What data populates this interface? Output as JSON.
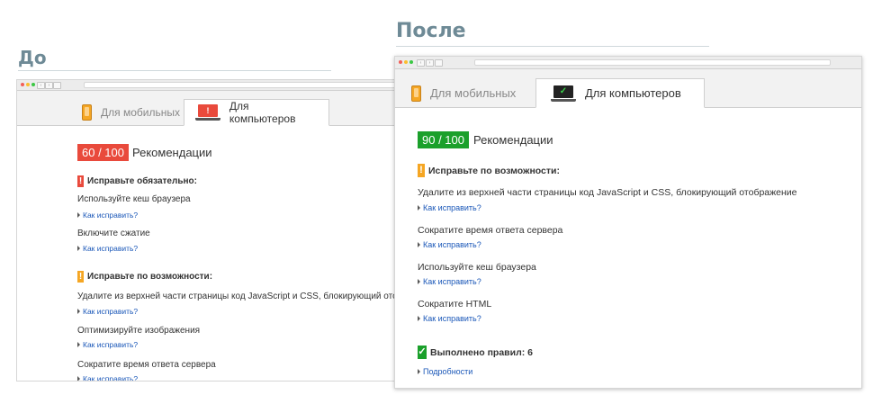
{
  "headings": {
    "before": "До",
    "after": "После"
  },
  "tabs": {
    "mobile": "Для мобильных",
    "desktop": "Для компьютеров"
  },
  "before": {
    "score": "60 / 100",
    "score_label": "Рекомендации",
    "sections": [
      {
        "title": "Исправьте обязательно:",
        "badge": "!",
        "rules": [
          {
            "text": "Используйте кеш браузера",
            "link": "Как исправить?"
          },
          {
            "text": "Включите сжатие",
            "link": "Как исправить?"
          }
        ]
      },
      {
        "title": "Исправьте по возможности:",
        "badge": "!",
        "rules": [
          {
            "text": "Удалите из верхней части страницы код JavaScript и CSS, блокирующий отобра",
            "link": "Как исправить?"
          },
          {
            "text": "Оптимизируйте изображения",
            "link": "Как исправить?"
          },
          {
            "text": "Сократите время ответа сервера",
            "link": "Как исправить?"
          }
        ]
      }
    ]
  },
  "after": {
    "score": "90 / 100",
    "score_label": "Рекомендации",
    "section_title": "Исправьте по возможности:",
    "badge": "!",
    "rules": [
      {
        "text": "Удалите из верхней части страницы код JavaScript и CSS, блокирующий отображение",
        "link": "Как исправить?"
      },
      {
        "text": "Сократите время ответа сервера",
        "link": "Как исправить?"
      },
      {
        "text": "Используйте кеш браузера",
        "link": "Как исправить?"
      },
      {
        "text": "Сократите HTML",
        "link": "Как исправить?"
      }
    ],
    "passed": "Выполнено правил: 6",
    "passed_badge": "✓",
    "details": "Подробности"
  },
  "colors": {
    "red": "#e94a3c",
    "orange": "#f5a623",
    "green": "#1ba02b",
    "link": "#1a57b8",
    "heading": "#6e8a96"
  },
  "icons": [
    "phone-icon",
    "laptop-alert-icon",
    "laptop-check-icon",
    "exclamation-icon",
    "check-icon",
    "triangle-right-icon"
  ]
}
